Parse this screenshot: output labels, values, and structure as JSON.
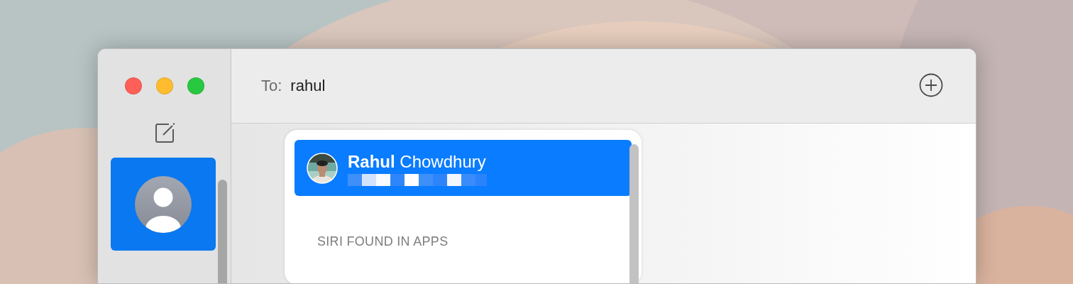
{
  "window": {
    "traffic_lights": [
      {
        "color": "#fe5f57"
      },
      {
        "color": "#febc2e"
      },
      {
        "color": "#28c840"
      }
    ]
  },
  "sidebar": {
    "conversations": [
      {
        "kind": "contact",
        "selected": true
      }
    ]
  },
  "header": {
    "to_label": "To:",
    "to_value": "rahul"
  },
  "suggestions": {
    "items": [
      {
        "name": "**Rahul** Chowdhury",
        "selected": true
      }
    ],
    "section_heading": "SIRI FOUND IN APPS"
  }
}
